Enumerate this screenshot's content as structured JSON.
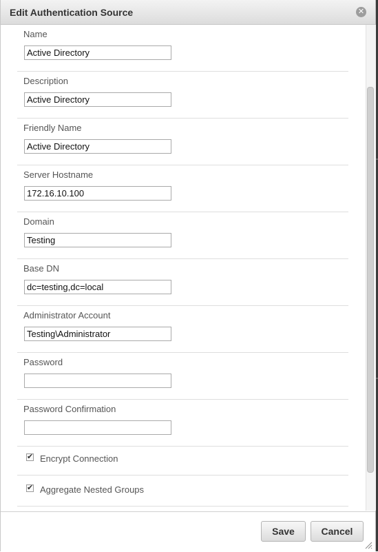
{
  "dialog": {
    "title": "Edit Authentication Source",
    "close_icon": "close-icon"
  },
  "fields": {
    "name": {
      "label": "Name",
      "value": "Active Directory"
    },
    "description": {
      "label": "Description",
      "value": "Active Directory"
    },
    "friendly_name": {
      "label": "Friendly Name",
      "value": "Active Directory"
    },
    "server_hostname": {
      "label": "Server Hostname",
      "value": "172.16.10.100"
    },
    "domain": {
      "label": "Domain",
      "value": "Testing"
    },
    "base_dn": {
      "label": "Base DN",
      "value": "dc=testing,dc=local"
    },
    "admin_account": {
      "label": "Administrator Account",
      "value": "Testing\\Administrator"
    },
    "password": {
      "label": "Password",
      "value": ""
    },
    "password_confirmation": {
      "label": "Password Confirmation",
      "value": ""
    }
  },
  "checkboxes": {
    "encrypt_connection": {
      "label": "Encrypt Connection",
      "checked": true
    },
    "aggregate_nested_groups": {
      "label": "Aggregate Nested Groups",
      "checked": true
    }
  },
  "footer": {
    "save_label": "Save",
    "cancel_label": "Cancel"
  }
}
